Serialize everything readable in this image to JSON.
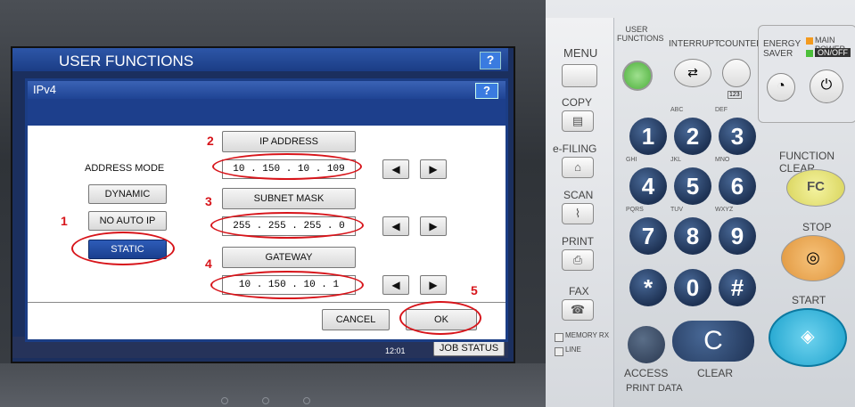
{
  "screen": {
    "title": "USER FUNCTIONS",
    "help": "?",
    "dialog": {
      "title": "IPv4",
      "help": "?",
      "address_mode_label": "ADDRESS MODE",
      "modes": [
        "DYNAMIC",
        "NO AUTO IP",
        "STATIC"
      ],
      "selected_mode": "STATIC",
      "ip_address_label": "IP ADDRESS",
      "ip_address_value": "10 . 150 . 10 . 109",
      "subnet_mask_label": "SUBNET MASK",
      "subnet_mask_value": "255 . 255 . 255 . 0",
      "gateway_label": "GATEWAY",
      "gateway_value": "10 . 150 . 10 . 1",
      "cancel": "CANCEL",
      "ok": "OK",
      "arrow_left": "◀",
      "arrow_right": "▶"
    },
    "status_time": "12:01",
    "job_status": "JOB STATUS"
  },
  "annotations": {
    "n1": "1",
    "n2": "2",
    "n3": "3",
    "n4": "4",
    "n5": "5",
    "color": "#d7141a"
  },
  "panel": {
    "menu": "MENU",
    "user_functions": "USER FUNCTIONS",
    "interrupt": "INTERRUPT",
    "counter": "COUNTER",
    "counter_sub": "123",
    "energy_saver": "ENERGY SAVER",
    "main_power": "MAIN POWER",
    "on_off": "ON/OFF",
    "copy": "COPY",
    "efiling": "e-FILING",
    "scan": "SCAN",
    "print": "PRINT",
    "fax": "FAX",
    "memory_rx": "MEMORY RX",
    "line": "LINE",
    "function_clear": "FUNCTION CLEAR",
    "fc": "FC",
    "stop": "STOP",
    "start": "START",
    "access": "ACCESS",
    "clear": "CLEAR",
    "clear_key": "C",
    "print_data": "PRINT DATA",
    "keys": [
      "1",
      "2",
      "3",
      "4",
      "5",
      "6",
      "7",
      "8",
      "9",
      "*",
      "0",
      "#"
    ],
    "key_letters": [
      "",
      "ABC",
      "DEF",
      "GHI",
      "JKL",
      "MNO",
      "PQRS",
      "TUV",
      "WXYZ",
      "",
      "",
      ""
    ]
  }
}
